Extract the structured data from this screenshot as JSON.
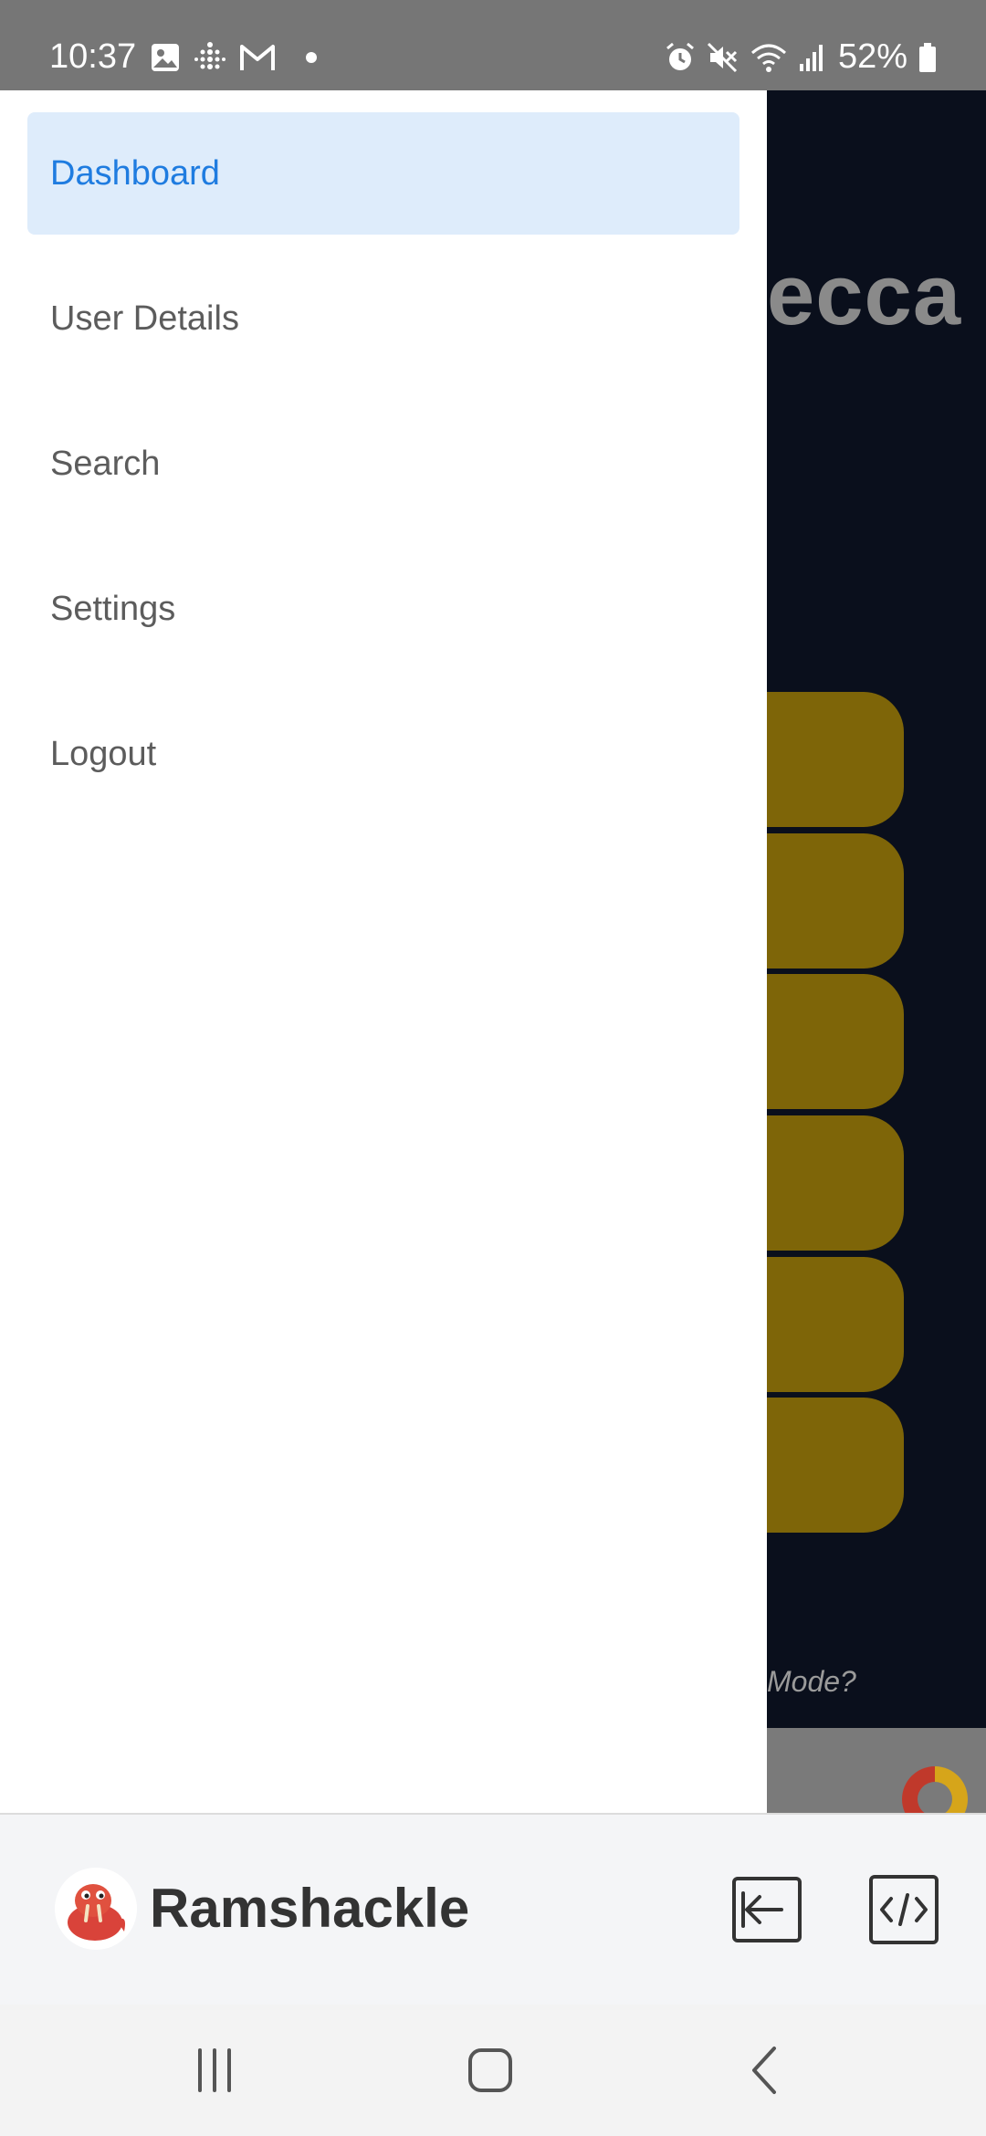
{
  "status_bar": {
    "time": "10:37",
    "battery_text": "52%",
    "notification_icons": [
      "gallery-icon",
      "fitbit-icon",
      "gmail-icon",
      "dot-icon"
    ],
    "system_icons": [
      "alarm-icon",
      "mute-icon",
      "wifi-icon",
      "signal-icon",
      "battery-icon"
    ]
  },
  "background_app": {
    "title_fragment": "ecca",
    "hint_fragment": "Mode?",
    "tile_color": "#7e6508",
    "background_color": "#0a0f1c"
  },
  "drawer": {
    "items": [
      {
        "label": "Dashboard",
        "active": true
      },
      {
        "label": "User Details",
        "active": false
      },
      {
        "label": "Search",
        "active": false
      },
      {
        "label": "Settings",
        "active": false
      },
      {
        "label": "Logout",
        "active": false
      }
    ],
    "active_color": "#1f7ce0",
    "active_bg": "#deecfb"
  },
  "footer": {
    "app_name": "Ramshackle",
    "actions": [
      "exit-icon",
      "code-icon"
    ]
  },
  "system_nav": {
    "buttons": [
      "recents-icon",
      "home-icon",
      "back-icon"
    ]
  }
}
